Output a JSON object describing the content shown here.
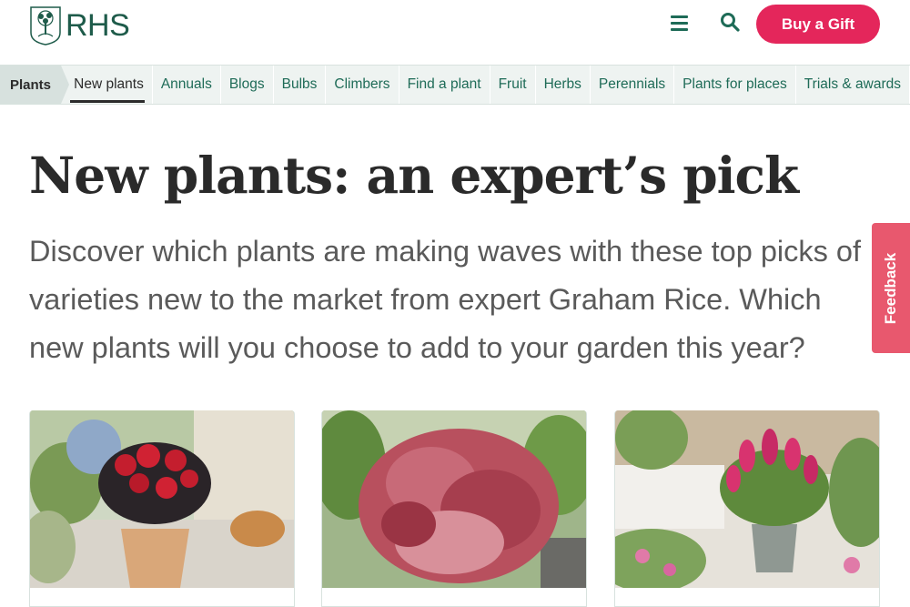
{
  "header": {
    "logo_text": "RHS",
    "gift_button": "Buy a Gift"
  },
  "nav": {
    "current": "Plants",
    "items": [
      {
        "label": "New plants"
      },
      {
        "label": "Annuals"
      },
      {
        "label": "Blogs"
      },
      {
        "label": "Bulbs"
      },
      {
        "label": "Climbers"
      },
      {
        "label": "Find a plant"
      },
      {
        "label": "Fruit"
      },
      {
        "label": "Herbs"
      },
      {
        "label": "Perennials"
      },
      {
        "label": "Plants for places"
      },
      {
        "label": "Trials & awards"
      }
    ]
  },
  "page": {
    "title": "New plants: an expert’s pick",
    "intro": "Discover which plants are making waves with these top picks of varieties new to the market from expert Graham Rice. Which new plants will you choose to add to your garden this year?"
  },
  "feedback": "Feedback",
  "colors": {
    "brand_green": "#1e6b57",
    "accent_pink": "#e4265b",
    "feedback_pink": "#e8586e",
    "nav_bg": "#eef3f1"
  },
  "icons": [
    "rhs-tree-logo-icon",
    "menu-icon",
    "search-icon"
  ]
}
